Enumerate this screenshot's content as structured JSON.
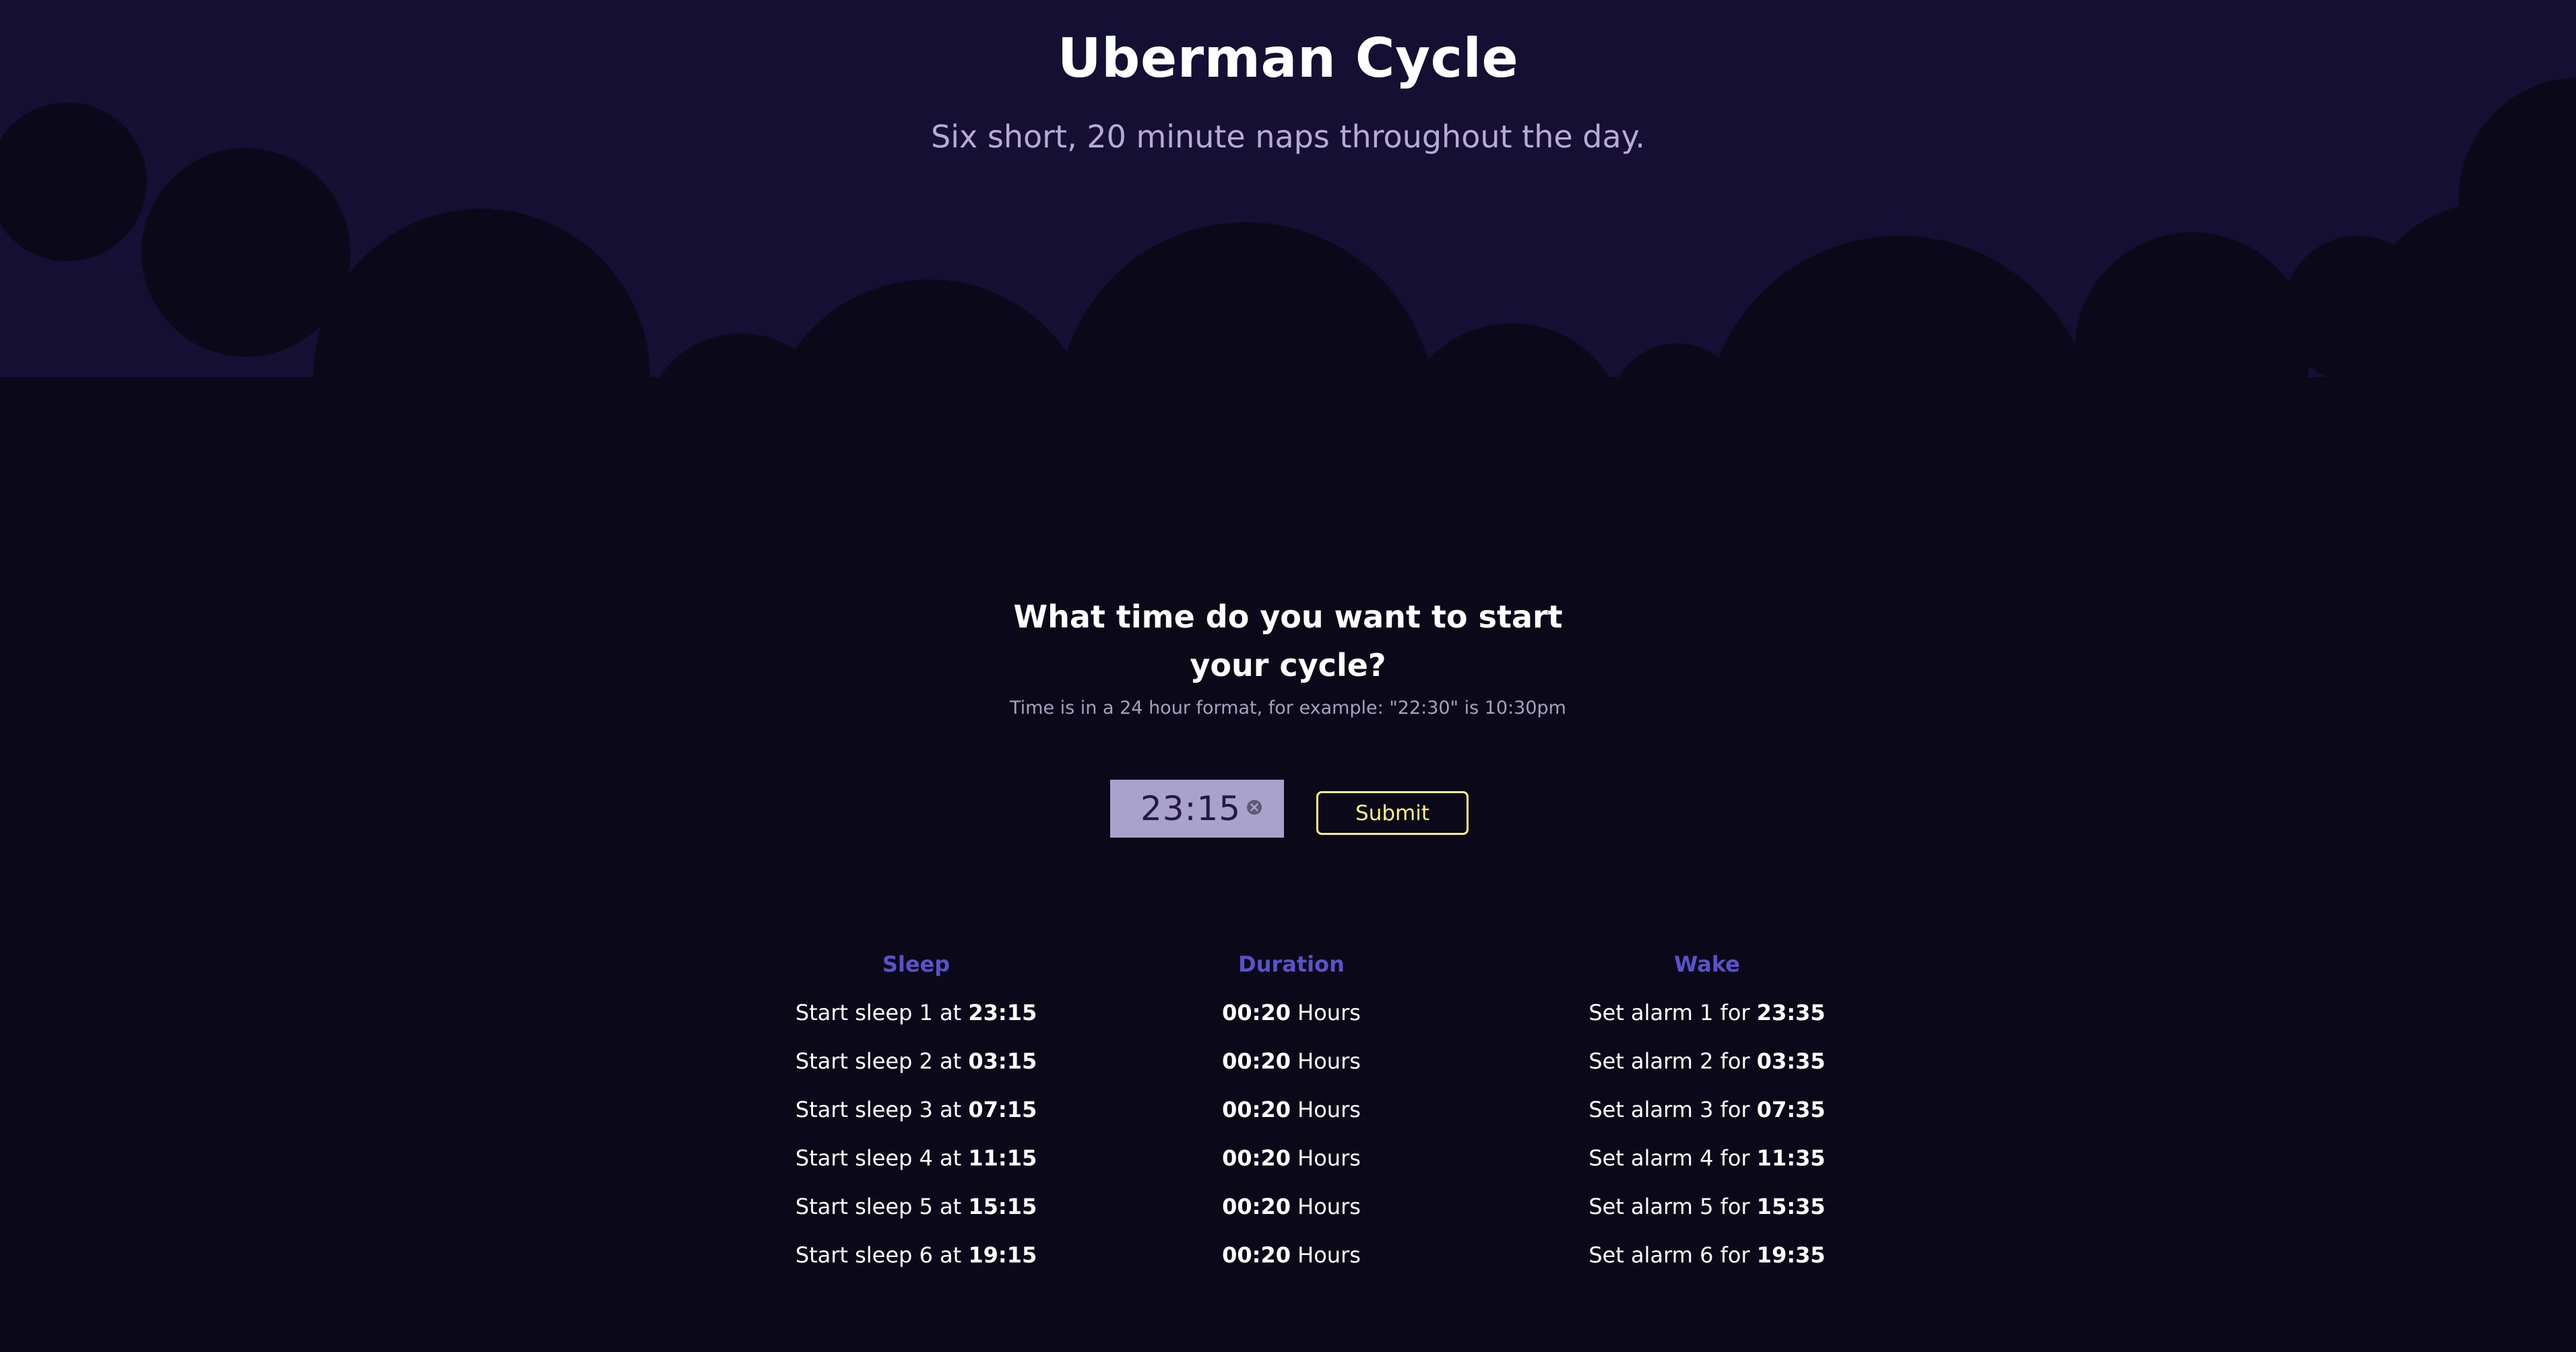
{
  "header": {
    "title": "Uberman Cycle",
    "subtitle": "Six short, 20 minute naps throughout the day."
  },
  "form": {
    "question": "What time do you want to start your cycle?",
    "hint": "Time is in a 24 hour format, for example: \"22:30\" is 10:30pm",
    "time_value": "23:15",
    "submit_label": "Submit"
  },
  "schedule": {
    "headers": {
      "sleep": "Sleep",
      "duration": "Duration",
      "wake": "Wake"
    },
    "rows": [
      {
        "sleep_prefix": "Start sleep 1 at",
        "sleep_time": "23:15",
        "duration": "00:20",
        "duration_unit": "Hours",
        "wake_prefix": "Set alarm 1 for",
        "wake_time": "23:35"
      },
      {
        "sleep_prefix": "Start sleep 2 at",
        "sleep_time": "03:15",
        "duration": "00:20",
        "duration_unit": "Hours",
        "wake_prefix": "Set alarm 2 for",
        "wake_time": "03:35"
      },
      {
        "sleep_prefix": "Start sleep 3 at",
        "sleep_time": "07:15",
        "duration": "00:20",
        "duration_unit": "Hours",
        "wake_prefix": "Set alarm 3 for",
        "wake_time": "07:35"
      },
      {
        "sleep_prefix": "Start sleep 4 at",
        "sleep_time": "11:15",
        "duration": "00:20",
        "duration_unit": "Hours",
        "wake_prefix": "Set alarm 4 for",
        "wake_time": "11:35"
      },
      {
        "sleep_prefix": "Start sleep 5 at",
        "sleep_time": "15:15",
        "duration": "00:20",
        "duration_unit": "Hours",
        "wake_prefix": "Set alarm 5 for",
        "wake_time": "15:35"
      },
      {
        "sleep_prefix": "Start sleep 6 at",
        "sleep_time": "19:15",
        "duration": "00:20",
        "duration_unit": "Hours",
        "wake_prefix": "Set alarm 6 for",
        "wake_time": "19:35"
      }
    ]
  },
  "colors": {
    "header_bg": "#140f33",
    "page_bg": "#0b0919",
    "accent_heading": "#5a52c8",
    "submit_accent": "#ffef84",
    "input_bg": "#a9a2cc"
  },
  "icons": {
    "clear": "clear-icon"
  }
}
